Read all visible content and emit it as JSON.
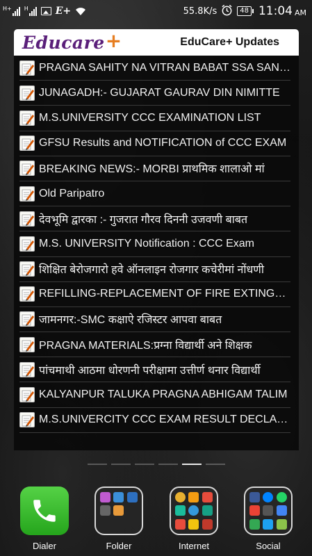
{
  "status_bar": {
    "network_speed": "55.8K/s",
    "battery": "48",
    "time": "11:04",
    "ampm": "AM",
    "signal1_tag": "H+",
    "signal2_tag": "H",
    "carrier_icon": "E+",
    "icons": [
      "signal-icon",
      "signal-icon",
      "image-icon",
      "eplus-icon",
      "wifi-icon",
      "alarm-icon",
      "battery-icon"
    ]
  },
  "widget": {
    "logo": {
      "text": "Educare",
      "plus": "+"
    },
    "title": "EduCare+ Updates",
    "items": [
      {
        "title": "PRAGNA SAHITY NA VITRAN BABAT SSA SANDESH"
      },
      {
        "title": "JUNAGADH:- GUJARAT GAURAV DIN NIMITTE"
      },
      {
        "title": "M.S.UNIVERSITY CCC EXAMINATION LIST"
      },
      {
        "title": "GFSU Results and NOTIFICATION of CCC EXAM"
      },
      {
        "title": "BREAKING NEWS:- MORBI प्राथमिक शालाओ मां"
      },
      {
        "title": "Old Paripatro"
      },
      {
        "title": "देवभूमि द्वारका :- गुजरात गौरव दिननी उजवणी बाबत"
      },
      {
        "title": "M.S. UNIVERSITY Notification : CCC Exam"
      },
      {
        "title": "शिक्षित बेरोजगारो हवे ऑनलाइन रोजगार कचेरीमां नोंधणी"
      },
      {
        "title": "REFILLING-REPLACEMENT OF FIRE EXTINGUISHER"
      },
      {
        "title": "जामनगर:-SMC कक्षाऐ रजिस्टर आपवा बाबत"
      },
      {
        "title": "PRAGNA MATERIALS:प्रग्ना विद्यार्थी अने शिक्षक"
      },
      {
        "title": "पांचमाथी आठमा धोरणनी परीक्षामा उत्तीर्ण थनार विद्यार्थी"
      },
      {
        "title": "KALYANPUR TALUKA PRAGNA ABHIGAM TALIM"
      },
      {
        "title": "M.S.UNIVERCITY CCC EXAM RESULT DECLARED"
      }
    ]
  },
  "dock": {
    "apps": [
      {
        "label": "Dialer",
        "icon": "phone-icon",
        "color": "#2fb524"
      },
      {
        "label": "Folder",
        "icon": "folder-icon"
      },
      {
        "label": "Internet",
        "icon": "folder-icon"
      },
      {
        "label": "Social",
        "icon": "folder-icon"
      }
    ]
  }
}
